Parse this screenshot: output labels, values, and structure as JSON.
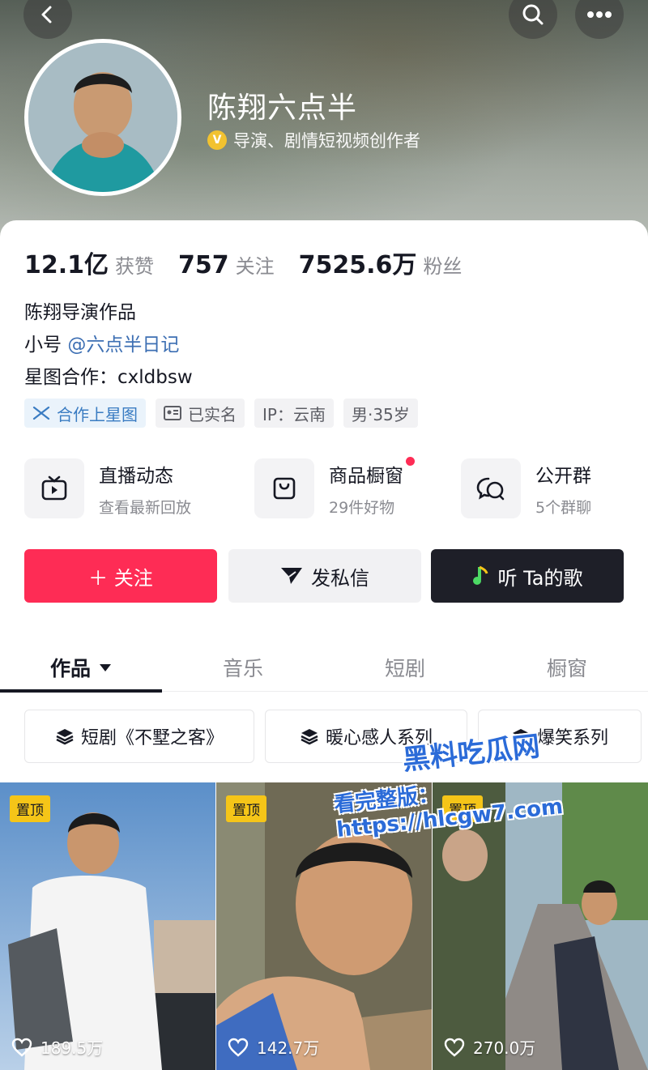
{
  "profile": {
    "name": "陈翔六点半",
    "verified_label": "导演、剧情短视频创作者"
  },
  "stats": [
    {
      "value": "12.1亿",
      "label": "获赞"
    },
    {
      "value": "757",
      "label": "关注"
    },
    {
      "value": "7525.6万",
      "label": "粉丝"
    }
  ],
  "bio": {
    "line1": "陈翔导演作品",
    "line2_prefix": "小号 ",
    "line2_link": "@六点半日记",
    "line3": "星图合作：cxldbsw"
  },
  "tags": [
    {
      "label": "合作上星图",
      "icon": "star-map-icon"
    },
    {
      "label": "已实名",
      "icon": "id-card-icon"
    },
    {
      "label": "IP：云南"
    },
    {
      "label": "男·35岁"
    }
  ],
  "features": [
    {
      "title": "直播动态",
      "subtitle": "查看最新回放",
      "icon": "tv-icon"
    },
    {
      "title": "商品橱窗",
      "subtitle": "29件好物",
      "icon": "shopping-bag-icon",
      "badge": true
    },
    {
      "title": "公开群",
      "subtitle": "5个群聊",
      "icon": "chat-group-icon"
    }
  ],
  "actions": {
    "follow": "＋ 关注",
    "message": "发私信",
    "music": "听 Ta的歌"
  },
  "tabs": [
    "作品",
    "音乐",
    "短剧",
    "橱窗"
  ],
  "active_tab": 0,
  "collections": [
    "短剧《不墅之客》",
    "暖心感人系列",
    "爆笑系列"
  ],
  "videos": [
    {
      "pin": "置顶",
      "likes": "189.5万"
    },
    {
      "pin": "置顶",
      "likes": "142.7万"
    },
    {
      "pin": "置顶",
      "likes": "270.0万"
    }
  ],
  "watermark": {
    "title": "黑料吃瓜网",
    "line": "看完整版：https://hlcgw7.com"
  },
  "colors": {
    "accent": "#fe2c55",
    "link": "#3d6fb3",
    "pin": "#f5c518",
    "dark_button": "#1e1f28"
  }
}
